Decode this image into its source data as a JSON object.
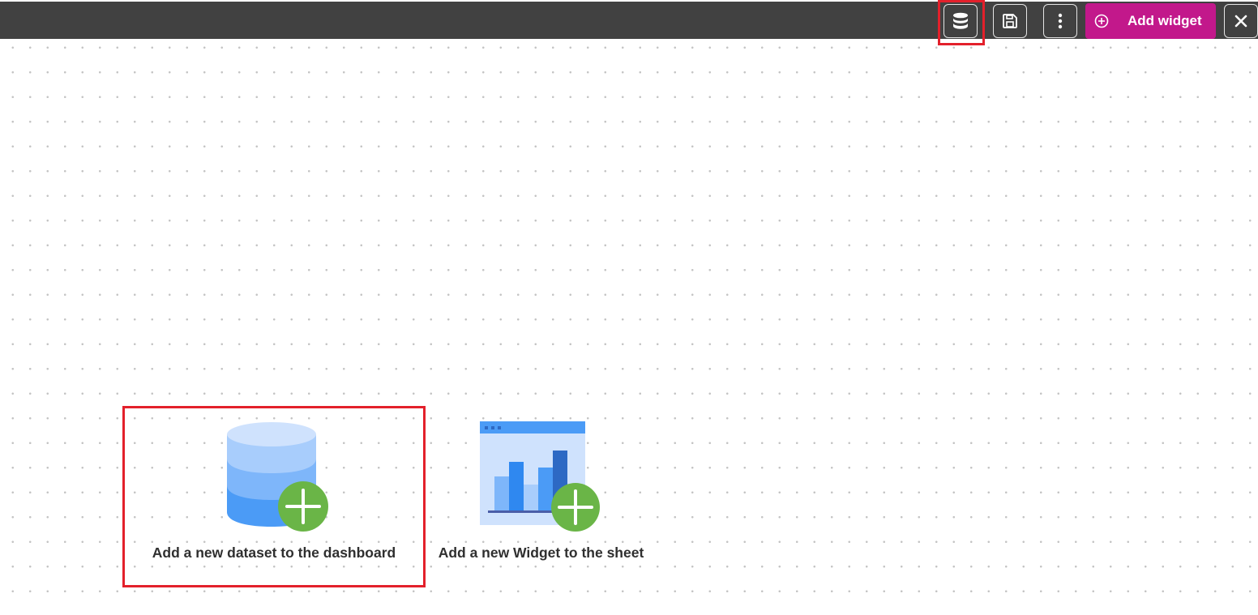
{
  "toolbar": {
    "background": "#414141",
    "buttons": [
      {
        "name": "dataset",
        "icon": "database-icon"
      },
      {
        "name": "save",
        "icon": "floppy-disk-icon"
      },
      {
        "name": "more",
        "icon": "more-vertical-icon"
      }
    ],
    "add_widget": {
      "label": "Add widget",
      "icon": "plus-circle-icon",
      "color": "#c2188b"
    },
    "close_icon": "close-icon"
  },
  "canvas": {
    "pattern": "dot-grid",
    "dot_color": "#c4c4c4"
  },
  "cards": {
    "dataset": {
      "label": "Add a new dataset to the dashboard",
      "icon": "database-add-icon"
    },
    "widget": {
      "label": "Add a new Widget to the sheet",
      "icon": "chart-widget-add-icon"
    }
  },
  "highlight_color": "#e3202b"
}
